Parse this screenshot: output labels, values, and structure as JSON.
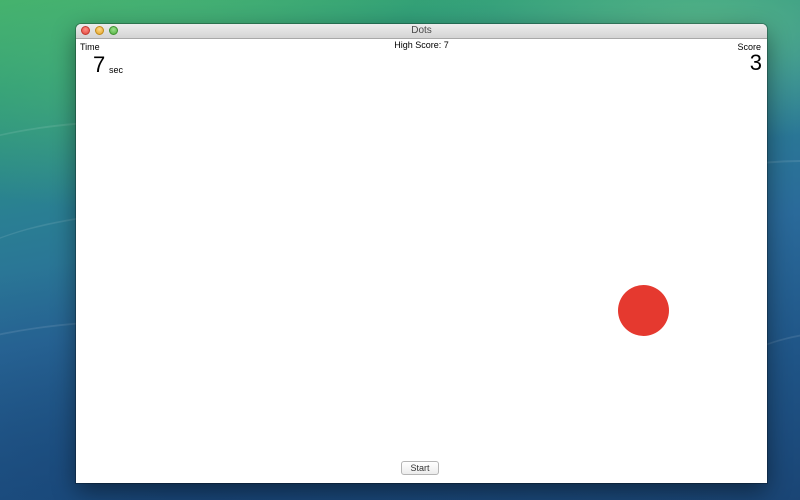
{
  "window": {
    "title": "Dots"
  },
  "hud": {
    "time_label": "Time",
    "time_value": "7",
    "time_unit": "sec",
    "high_score_label": "High Score:",
    "high_score_value": "7",
    "score_label": "Score",
    "score_value": "3"
  },
  "game": {
    "dot_color": "#e5392f"
  },
  "controls": {
    "start_label": "Start"
  }
}
